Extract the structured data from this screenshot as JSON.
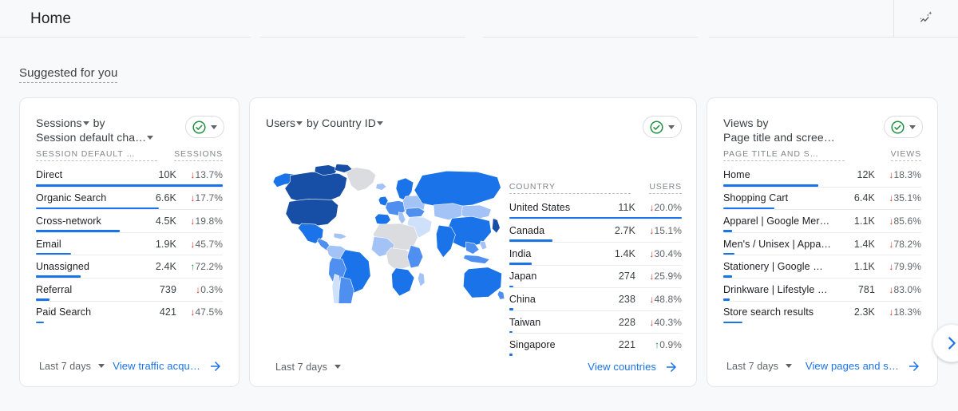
{
  "appbar": {
    "title": "Home",
    "insights_icon": "insights-sparkle-icon"
  },
  "section": {
    "title": "Suggested for you",
    "next_icon": "chevron-right-icon"
  },
  "cards": [
    {
      "title_line1": "Sessions",
      "title_line1_suffix": " by",
      "title_line2": "Session default cha…",
      "title_line1_caret": true,
      "title_line2_caret": true,
      "status_icon": "check-circle-icon",
      "status_caret_icon": "chevron-down-icon",
      "columns": {
        "dimension": "SESSION DEFAULT …",
        "metric": "SESSIONS"
      },
      "rows": [
        {
          "dimension": "Direct",
          "value": "10K",
          "delta": "13.7%",
          "direction": "down",
          "bar_pct": 100
        },
        {
          "dimension": "Organic Search",
          "value": "6.6K",
          "delta": "17.7%",
          "direction": "down",
          "bar_pct": 66
        },
        {
          "dimension": "Cross-network",
          "value": "4.5K",
          "delta": "19.8%",
          "direction": "down",
          "bar_pct": 45
        },
        {
          "dimension": "Email",
          "value": "1.9K",
          "delta": "45.7%",
          "direction": "down",
          "bar_pct": 19
        },
        {
          "dimension": "Unassigned",
          "value": "2.4K",
          "delta": "72.2%",
          "direction": "up",
          "bar_pct": 24
        },
        {
          "dimension": "Referral",
          "value": "739",
          "delta": "0.3%",
          "direction": "down",
          "bar_pct": 7.4
        },
        {
          "dimension": "Paid Search",
          "value": "421",
          "delta": "47.5%",
          "direction": "down",
          "bar_pct": 4.2
        }
      ],
      "footer": {
        "date_range": "Last 7 days",
        "date_caret_icon": "chevron-down-icon",
        "link_label": "View traffic acqu…",
        "link_arrow_icon": "arrow-right-icon"
      }
    },
    {
      "title_line1": "Users",
      "title_line1_suffix": " by Country ID",
      "title_line1_caret": true,
      "title_line2_caret": true,
      "status_icon": "check-circle-icon",
      "status_caret_icon": "chevron-down-icon",
      "columns": {
        "dimension": "COUNTRY",
        "metric": "USERS"
      },
      "rows": [
        {
          "dimension": "United States",
          "value": "11K",
          "delta": "20.0%",
          "direction": "down",
          "bar_pct": 100
        },
        {
          "dimension": "Canada",
          "value": "2.7K",
          "delta": "15.1%",
          "direction": "down",
          "bar_pct": 25
        },
        {
          "dimension": "India",
          "value": "1.4K",
          "delta": "30.4%",
          "direction": "down",
          "bar_pct": 13
        },
        {
          "dimension": "Japan",
          "value": "274",
          "delta": "25.9%",
          "direction": "down",
          "bar_pct": 2.5
        },
        {
          "dimension": "China",
          "value": "238",
          "delta": "48.8%",
          "direction": "down",
          "bar_pct": 2.2
        },
        {
          "dimension": "Taiwan",
          "value": "228",
          "delta": "40.3%",
          "direction": "down",
          "bar_pct": 2.1
        },
        {
          "dimension": "Singapore",
          "value": "221",
          "delta": "0.9%",
          "direction": "up",
          "bar_pct": 2.0
        }
      ],
      "footer": {
        "date_range": "Last 7 days",
        "date_caret_icon": "chevron-down-icon",
        "link_label": "View countries",
        "link_arrow_icon": "arrow-right-icon"
      }
    },
    {
      "title_line1": "Views by",
      "title_line2": "Page title and scree…",
      "title_line1_caret": false,
      "title_line2_caret": false,
      "status_icon": "check-circle-icon",
      "status_caret_icon": "chevron-down-icon",
      "columns": {
        "dimension": "PAGE TITLE AND S…",
        "metric": "VIEWS"
      },
      "rows": [
        {
          "dimension": "Home",
          "value": "12K",
          "delta": "18.3%",
          "direction": "down",
          "bar_pct": 48
        },
        {
          "dimension": "Shopping Cart",
          "value": "6.4K",
          "delta": "35.1%",
          "direction": "down",
          "bar_pct": 26
        },
        {
          "dimension": "Apparel | Google Mer…",
          "value": "1.1K",
          "delta": "85.6%",
          "direction": "down",
          "bar_pct": 4.5
        },
        {
          "dimension": "Men's / Unisex | Appa…",
          "value": "1.4K",
          "delta": "78.2%",
          "direction": "down",
          "bar_pct": 5.8
        },
        {
          "dimension": "Stationery | Google …",
          "value": "1.1K",
          "delta": "79.9%",
          "direction": "down",
          "bar_pct": 4.5
        },
        {
          "dimension": "Drinkware | Lifestyle …",
          "value": "781",
          "delta": "83.0%",
          "direction": "down",
          "bar_pct": 3.2
        },
        {
          "dimension": "Store search results",
          "value": "2.3K",
          "delta": "18.3%",
          "direction": "down",
          "bar_pct": 9.5
        }
      ],
      "footer": {
        "date_range": "Last 7 days",
        "date_caret_icon": "chevron-down-icon",
        "link_label": "View pages and s…",
        "link_arrow_icon": "arrow-right-icon"
      }
    }
  ],
  "map": {
    "name": "world-choropleth-map",
    "legend_colors": {
      "high": "#174ea6",
      "mid_high": "#1a73e8",
      "mid": "#4e8ff0",
      "low": "#a3c3f7",
      "lowest": "#cfe0fb",
      "no_data": "#dadce0"
    }
  },
  "colors": {
    "accent": "#1a73e8",
    "positive": "#1e8e3e",
    "negative": "#d93025",
    "page_bg": "#f8f9fa",
    "card_bg": "#ffffff"
  }
}
